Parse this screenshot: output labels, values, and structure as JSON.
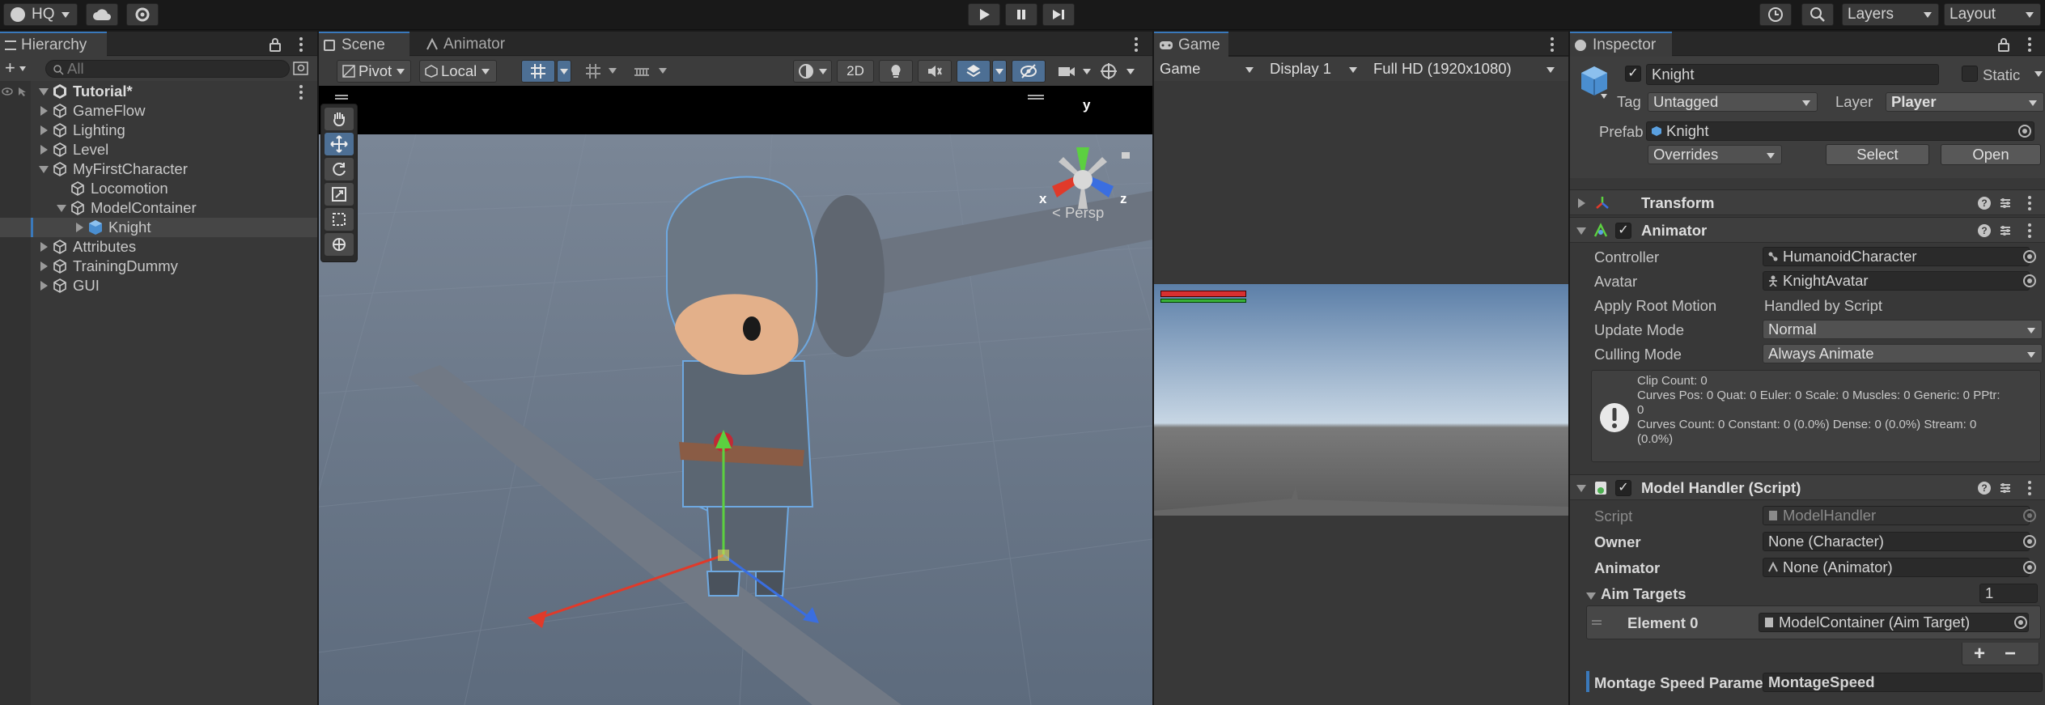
{
  "toolbar": {
    "account": "HQ",
    "layers": "Layers",
    "layout": "Layout"
  },
  "hierarchy": {
    "tab": "Hierarchy",
    "search_placeholder": "All",
    "scene": "Tutorial*",
    "items": [
      {
        "label": "GameFlow"
      },
      {
        "label": "Lighting"
      },
      {
        "label": "Level"
      },
      {
        "label": "MyFirstCharacter"
      },
      {
        "label": "Locomotion"
      },
      {
        "label": "ModelContainer"
      },
      {
        "label": "Knight"
      },
      {
        "label": "Attributes"
      },
      {
        "label": "TrainingDummy"
      },
      {
        "label": "GUI"
      }
    ]
  },
  "scene_view": {
    "tabs": [
      "Scene",
      "Animator"
    ],
    "pivot": "Pivot",
    "local": "Local",
    "mode_2d": "2D",
    "gizmo": {
      "x": "x",
      "y": "y",
      "z": "z",
      "projection": "Persp"
    }
  },
  "game_view": {
    "tab": "Game",
    "view_select": "Game",
    "display": "Display 1",
    "resolution": "Full HD (1920x1080)"
  },
  "inspector": {
    "tab": "Inspector",
    "object_name": "Knight",
    "static_label": "Static",
    "tag_label": "Tag",
    "tag_value": "Untagged",
    "layer_label": "Layer",
    "layer_value": "Player",
    "prefab_label": "Prefab",
    "prefab_value": "Knight",
    "overrides": "Overrides",
    "select": "Select",
    "open": "Open",
    "transform": "Transform",
    "animator": {
      "title": "Animator",
      "controller_label": "Controller",
      "controller_value": "HumanoidCharacter",
      "avatar_label": "Avatar",
      "avatar_value": "KnightAvatar",
      "root_motion_label": "Apply Root Motion",
      "root_motion_value": "Handled by Script",
      "update_mode_label": "Update Mode",
      "update_mode_value": "Normal",
      "culling_mode_label": "Culling Mode",
      "culling_mode_value": "Always Animate",
      "info_lines": [
        "Clip Count: 0",
        "Curves Pos: 0 Quat: 0 Euler: 0 Scale: 0 Muscles: 0 Generic: 0 PPtr:",
        "0",
        "Curves Count: 0 Constant: 0 (0.0%) Dense: 0 (0.0%) Stream: 0",
        "(0.0%)"
      ]
    },
    "model_handler": {
      "title": "Model Handler (Script)",
      "script_label": "Script",
      "script_value": "ModelHandler",
      "owner_label": "Owner",
      "owner_value": "None (Character)",
      "animator_label": "Animator",
      "animator_value": "None (Animator)",
      "aim_targets_label": "Aim Targets",
      "aim_targets_count": "1",
      "element_label": "Element 0",
      "element_value": "ModelContainer (Aim Target)",
      "plus": "+",
      "minus": "−",
      "montage_label": "Montage Speed Parame",
      "montage_value": "MontageSpeed"
    }
  },
  "colors": {
    "accent": "#3a79bb",
    "selected_row": "#464646",
    "panel_bg": "#383838",
    "health_red": "#d83030",
    "health_green": "#38b038"
  }
}
